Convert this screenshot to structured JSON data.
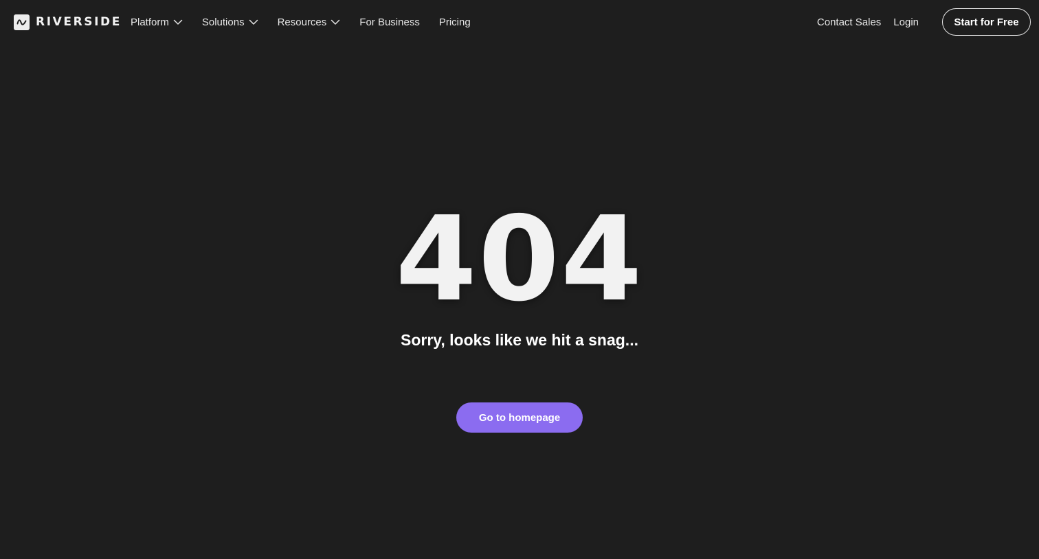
{
  "brand": {
    "name": "RIVERSIDE",
    "logo_icon": "waveform-icon"
  },
  "nav": {
    "items": [
      {
        "label": "Platform",
        "has_dropdown": true,
        "icon": "chevron-down-icon"
      },
      {
        "label": "Solutions",
        "has_dropdown": true,
        "icon": "chevron-down-icon"
      },
      {
        "label": "Resources",
        "has_dropdown": true,
        "icon": "chevron-down-icon"
      },
      {
        "label": "For Business",
        "has_dropdown": false
      },
      {
        "label": "Pricing",
        "has_dropdown": false
      }
    ],
    "contact_sales": "Contact Sales",
    "login": "Login",
    "start_free": "Start for Free"
  },
  "error": {
    "code": "404",
    "message": "Sorry, looks like we hit a snag...",
    "home_button": "Go to homepage"
  },
  "colors": {
    "background": "#1e1e1e",
    "accent": "#8b6cf0",
    "text": "#ffffff"
  }
}
